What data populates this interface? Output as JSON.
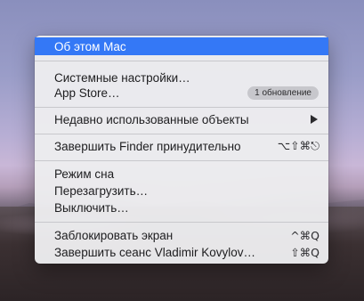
{
  "menu": {
    "about": "Об этом Mac",
    "system_prefs": "Системные настройки…",
    "app_store": "App Store…",
    "app_store_badge": "1 обновление",
    "recent_items": "Недавно использованные объекты",
    "force_quit": "Завершить Finder принудительно",
    "force_quit_shortcut": "⌥⇧⌘⎋",
    "sleep": "Режим сна",
    "restart": "Перезагрузить…",
    "shutdown": "Выключить…",
    "lock_screen": "Заблокировать экран",
    "lock_screen_shortcut": "^⌘Q",
    "log_out": "Завершить сеанс Vladimir Kovylov…",
    "log_out_shortcut": "⇧⌘Q"
  },
  "colors": {
    "highlight": "#3478f6",
    "menu_background": "#ececee",
    "separator": "#c8c8cc"
  },
  "icons": {
    "submenu": "chevron-right-icon"
  }
}
